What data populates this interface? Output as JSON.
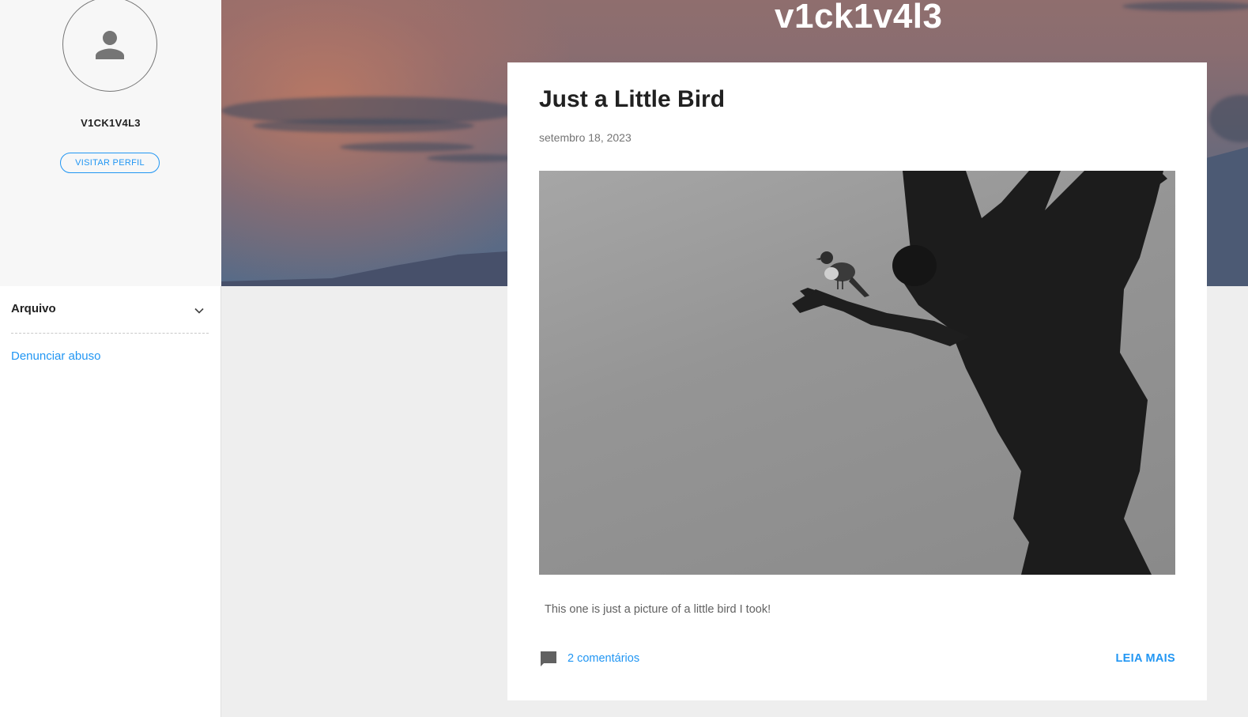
{
  "blog": {
    "title": "v1ck1v4l3"
  },
  "profile": {
    "name": "V1CK1V4L3",
    "visit_button": "VISITAR PERFIL",
    "avatar_icon": "person-icon"
  },
  "sidebar": {
    "archive_title": "Arquivo",
    "archive_icon": "chevron-down-icon",
    "report_link": "Denunciar abuso"
  },
  "post": {
    "title": "Just a Little Bird",
    "date": "setembro 18, 2023",
    "image_alt": "",
    "snippet": "This one is just a picture of a little bird I took!",
    "comments_label": "2 comentários",
    "comments_icon": "comment-icon",
    "read_more": "LEIA MAIS"
  },
  "colors": {
    "accent": "#2196f3",
    "text_primary": "#212121",
    "text_secondary": "#757575",
    "page_background": "#eeeeee"
  }
}
